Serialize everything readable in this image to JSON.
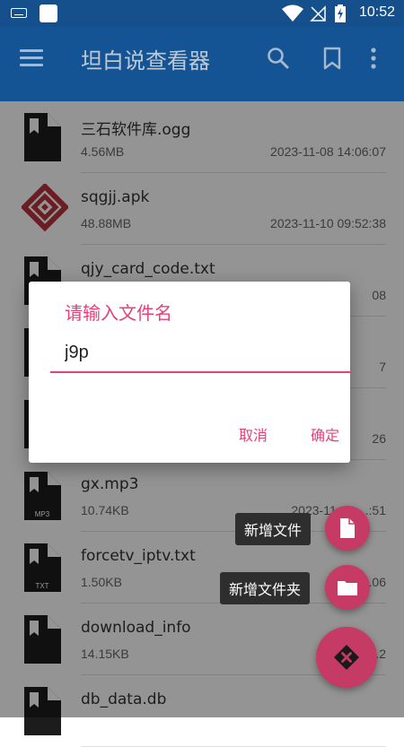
{
  "status_bar": {
    "time": "10:52",
    "icons": [
      "keyboard-icon",
      "notification-square-icon",
      "wifi-icon",
      "no-signal-icon",
      "battery-charging-icon"
    ]
  },
  "app_bar": {
    "title": "坦白说查看器",
    "icons": [
      "menu-icon",
      "search-icon",
      "bookmark-icon",
      "more-vert-icon"
    ]
  },
  "files": [
    {
      "name": "三石软件库.ogg",
      "size": "4.56MB",
      "date": "2023-11-08 14:06:07",
      "icon": "file-icon",
      "badge": ""
    },
    {
      "name": "sqgjj.apk",
      "size": "48.88MB",
      "date": "2023-11-10 09:52:38",
      "icon": "apk-logo-icon",
      "badge": ""
    },
    {
      "name": "qjy_card_code.txt",
      "size": "",
      "date": "",
      "icon": "file-icon",
      "badge": ""
    },
    {
      "name": "",
      "size": "",
      "date": "",
      "icon": "file-icon",
      "badge": ""
    },
    {
      "name": "",
      "size": "",
      "date": "",
      "icon": "file-icon",
      "badge": ""
    },
    {
      "name": "gx.mp3",
      "size": "10.74KB",
      "date": "2023-11-14 ...:51",
      "icon": "mp3-file-icon",
      "badge": "MP3"
    },
    {
      "name": "forcetv_iptv.txt",
      "size": "1.50KB",
      "date": "...06",
      "icon": "txt-file-icon",
      "badge": "TXT"
    },
    {
      "name": "download_info",
      "size": "14.15KB",
      "date": "2023-11-...2",
      "icon": "file-icon",
      "badge": ""
    },
    {
      "name": "db_data.db",
      "size": "",
      "date": "",
      "icon": "file-icon",
      "badge": ""
    }
  ],
  "partial_dates_behind_dialog": [
    "08",
    "7",
    "26"
  ],
  "dialog": {
    "title": "请输入文件名",
    "input_value": "j9p",
    "cancel_label": "取消",
    "confirm_label": "确定"
  },
  "fab_menu": {
    "new_file_label": "新增文件",
    "new_folder_label": "新增文件夹",
    "main_icon": "close-diamond-icon"
  },
  "colors": {
    "appbar": "#1760a9",
    "statusbar": "#154f8c",
    "accent": "#e5407b",
    "fab": "#c63b66"
  }
}
